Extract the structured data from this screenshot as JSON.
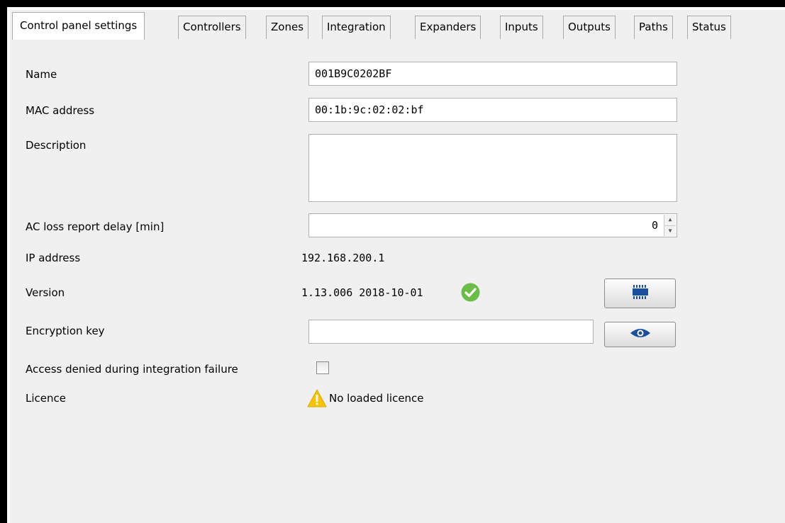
{
  "tabs": [
    {
      "label": "Control panel settings",
      "active": true
    },
    {
      "label": "Controllers"
    },
    {
      "label": "Zones"
    },
    {
      "label": "Integration"
    },
    {
      "label": "Expanders"
    },
    {
      "label": "Inputs"
    },
    {
      "label": "Outputs"
    },
    {
      "label": "Paths"
    },
    {
      "label": "Status"
    }
  ],
  "form": {
    "name_label": "Name",
    "name_value": "001B9C0202BF",
    "mac_label": "MAC address",
    "mac_value": "00:1b:9c:02:02:bf",
    "description_label": "Description",
    "description_value": "",
    "ac_loss_label": "AC loss report delay [min]",
    "ac_loss_value": "0",
    "ip_label": "IP address",
    "ip_value": "192.168.200.1",
    "version_label": "Version",
    "version_value": "1.13.006 2018-10-01",
    "encryption_label": "Encryption key",
    "encryption_value": "",
    "access_denied_label": "Access denied during integration failure",
    "access_denied_checked": false,
    "licence_label": "Licence",
    "licence_value": "No loaded licence"
  },
  "icons": {
    "version_status": "check-circle-icon",
    "update_firmware": "chip-icon",
    "show_key": "eye-icon",
    "licence_status": "warning-icon"
  },
  "colors": {
    "ok_green": "#6cbd45",
    "warning_yellow": "#f5c400",
    "accent_blue": "#1a4fa0"
  }
}
